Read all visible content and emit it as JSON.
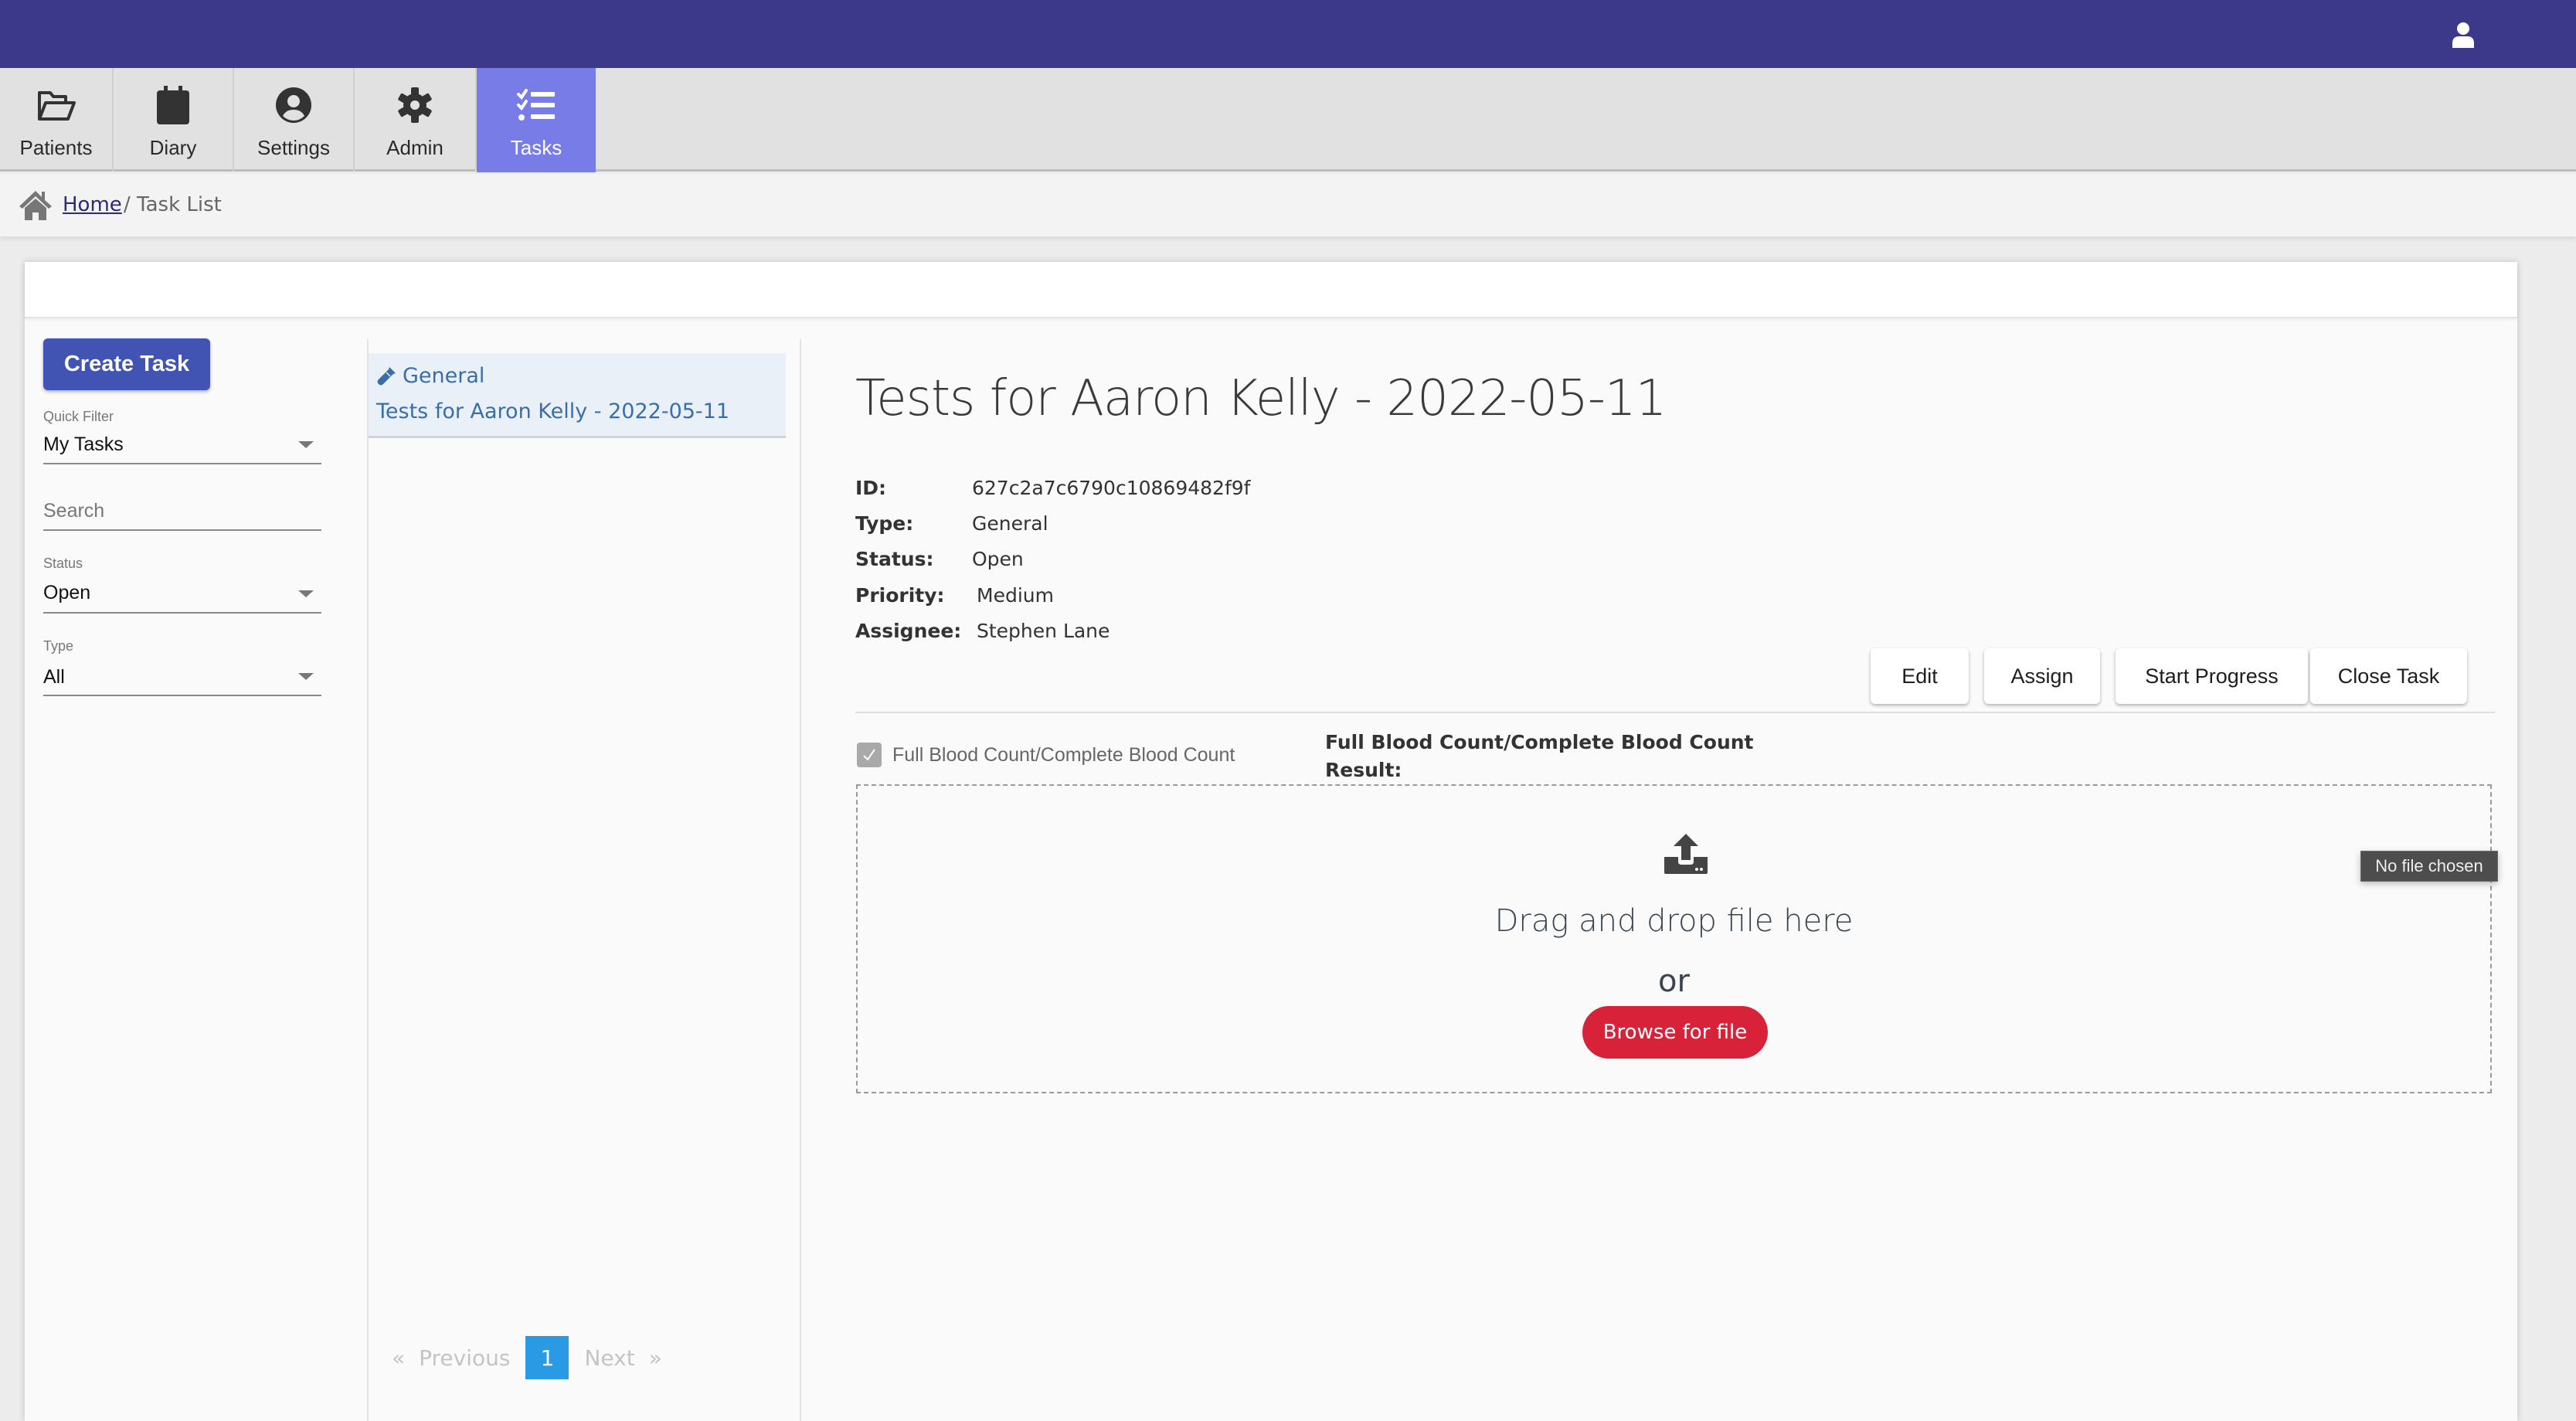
{
  "header": {
    "user_icon": "user-icon"
  },
  "nav": {
    "tabs": [
      {
        "label": "Patients",
        "icon": "folder-open-icon",
        "active": false
      },
      {
        "label": "Diary",
        "icon": "calendar-icon",
        "active": false
      },
      {
        "label": "Settings",
        "icon": "user-circle-icon",
        "active": false
      },
      {
        "label": "Admin",
        "icon": "gear-icon",
        "active": false
      },
      {
        "label": "Tasks",
        "icon": "task-list-icon",
        "active": true
      }
    ]
  },
  "breadcrumb": {
    "home": "Home",
    "separator": "/",
    "current": "Task List"
  },
  "sidebar": {
    "create_button": "Create Task",
    "quick_filter": {
      "label": "Quick Filter",
      "value": "My Tasks"
    },
    "search": {
      "placeholder": "Search",
      "value": ""
    },
    "status": {
      "label": "Status",
      "value": "Open"
    },
    "type": {
      "label": "Type",
      "value": "All"
    }
  },
  "task_list": {
    "items": [
      {
        "category": "General",
        "title": "Tests for Aaron Kelly - 2022-05-11",
        "icon": "test-tube-icon"
      }
    ],
    "pagination": {
      "prev": "Previous",
      "next": "Next",
      "prev_glyph": "«",
      "next_glyph": "»",
      "current_page": "1"
    }
  },
  "task": {
    "title": "Tests for Aaron Kelly - 2022-05-11",
    "fields": [
      {
        "key": "ID:",
        "value": "627c2a7c6790c10869482f9f"
      },
      {
        "key": "Type:",
        "value": "General"
      },
      {
        "key": "Status:",
        "value": "Open"
      },
      {
        "key": "Priority:",
        "value": "Medium"
      },
      {
        "key": "Assignee:",
        "value": "Stephen Lane"
      }
    ],
    "actions": [
      "Edit",
      "Assign",
      "Start Progress",
      "Close Task"
    ],
    "test_item": {
      "label": "Full Blood Count/Complete Blood Count",
      "checked": true
    },
    "result": {
      "title": "Full Blood Count/Complete Blood Count",
      "subtitle": "Result:"
    },
    "upload": {
      "drag_text": "Drag and drop file here",
      "or_text": "or",
      "browse_label": "Browse for file",
      "tooltip": "No file chosen"
    }
  },
  "colors": {
    "topbar": "#3c388a",
    "active_tab": "#787ce6",
    "primary_button": "#4153b3",
    "browse_button": "#d8223a",
    "page_active": "#2b9ae4",
    "link": "#3a6ea8"
  }
}
